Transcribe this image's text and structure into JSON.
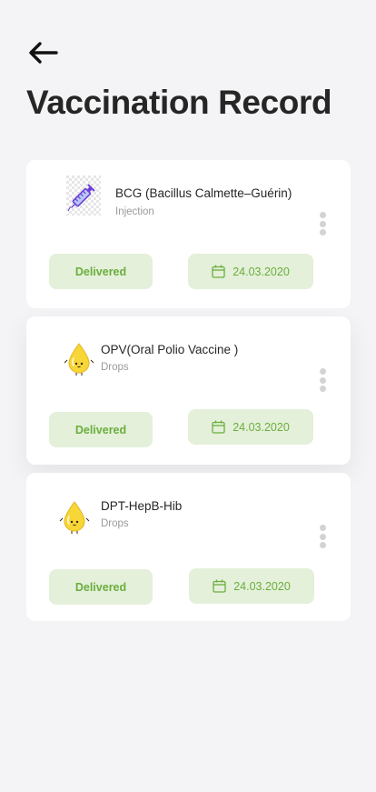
{
  "header": {
    "title": "Vaccination Record"
  },
  "vaccines": [
    {
      "name": "BCG (Bacillus Calmette–Guérin)",
      "type": "Injection",
      "status": "Delivered",
      "date": "24.03.2020",
      "icon": "syringe-icon"
    },
    {
      "name": "OPV(Oral Polio Vaccine )",
      "type": "Drops",
      "status": "Delivered",
      "date": "24.03.2020",
      "icon": "drop-icon"
    },
    {
      "name": "DPT-HepB-Hib",
      "type": "Drops",
      "status": "Delivered",
      "date": "24.03.2020",
      "icon": "drop-icon"
    }
  ],
  "colors": {
    "background": "#f4f4f6",
    "card": "#ffffff",
    "pill_bg": "#e4f0da",
    "pill_text": "#6aae3c",
    "drop": "#f7d637",
    "syringe": "#8a4ee6"
  }
}
